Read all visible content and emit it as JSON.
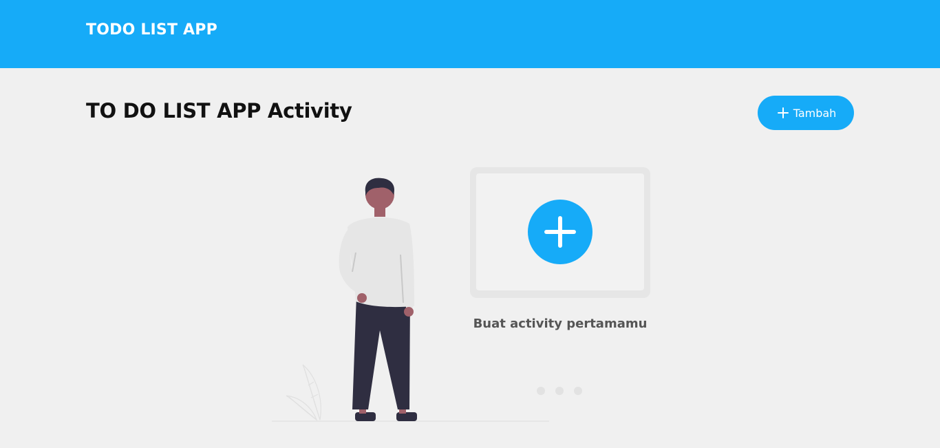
{
  "header": {
    "title": "TODO LIST APP"
  },
  "main": {
    "title": "TO DO LIST APP Activity",
    "add_button_label": "Tambah",
    "empty_state": {
      "caption": "Buat activity pertamamu"
    }
  },
  "colors": {
    "accent": "#16abf8",
    "background": "#f0f0f0",
    "header_text": "#ffffff",
    "title_text": "#111111",
    "caption_text": "#555555"
  },
  "icons": {
    "add_button": "plus-icon",
    "empty_state_card": "plus-circle-icon"
  }
}
